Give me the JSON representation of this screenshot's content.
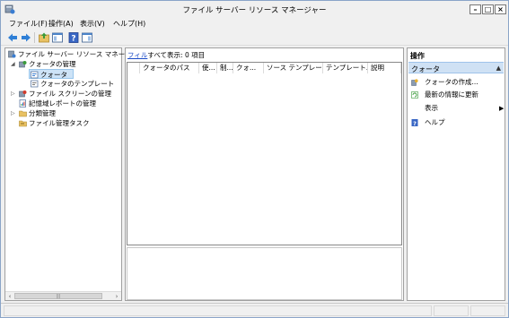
{
  "window": {
    "title": "ファイル サーバー リソース マネージャー"
  },
  "menu": [
    {
      "label": "ファイル(F)"
    },
    {
      "label": "操作(A)"
    },
    {
      "label": "表示(V)"
    },
    {
      "label": "ヘルプ(H)"
    }
  ],
  "tree": {
    "items": [
      {
        "label": "ファイル サーバー リソース マネージャー",
        "level": 0,
        "icon": "server-icon"
      },
      {
        "label": "クォータの管理",
        "level": 1,
        "icon": "quota-management-icon"
      },
      {
        "label": "クォータ",
        "level": 2,
        "icon": "quota-icon",
        "selected": true
      },
      {
        "label": "クォータのテンプレート",
        "level": 2,
        "icon": "quota-template-icon"
      },
      {
        "label": "ファイル スクリーンの管理",
        "level": 1,
        "icon": "file-screen-icon"
      },
      {
        "label": "記憶域レポートの管理",
        "level": 1,
        "icon": "storage-report-icon"
      },
      {
        "label": "分類管理",
        "level": 1,
        "icon": "classification-folder-icon"
      },
      {
        "label": "ファイル管理タスク",
        "level": 1,
        "icon": "file-task-icon"
      }
    ]
  },
  "center": {
    "filter_link": "フィル",
    "filter_text": "すべて表示: 0 項目",
    "columns": [
      {
        "label": ""
      },
      {
        "label": "クォータのパス"
      },
      {
        "label": "使..."
      },
      {
        "label": "制..."
      },
      {
        "label": "クォ..."
      },
      {
        "label": "ソース テンプレート"
      },
      {
        "label": "テンプレート..."
      },
      {
        "label": "説明"
      }
    ]
  },
  "actions": {
    "title": "操作",
    "section": "クォータ",
    "items": [
      {
        "label": "クォータの作成...",
        "icon": "create-quota-icon"
      },
      {
        "label": "最新の情報に更新",
        "icon": "refresh-icon"
      },
      {
        "label": "表示",
        "icon": "",
        "submenu": true
      },
      {
        "label": "ヘルプ",
        "icon": "help-icon"
      }
    ]
  }
}
